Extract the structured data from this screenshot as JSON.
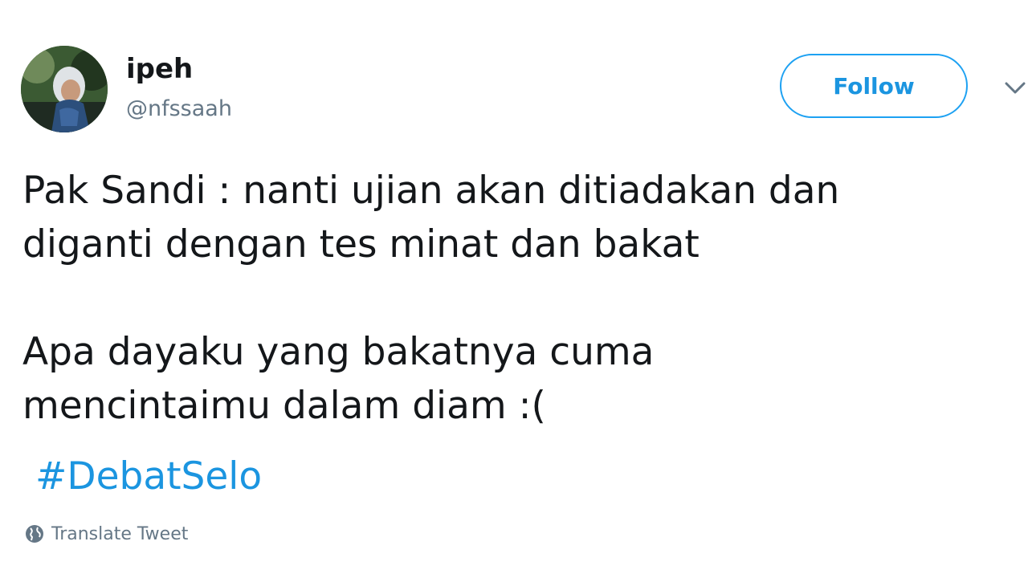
{
  "author": {
    "display_name": "ipeh",
    "handle": "@nfssaah"
  },
  "follow_button": {
    "label": "Follow"
  },
  "tweet": {
    "line1": "Pak Sandi : nanti ujian akan ditiadakan dan\ndiganti dengan tes minat dan bakat",
    "line2": "Apa dayaku yang bakatnya cuma\nmencintaimu dalam diam :(",
    "hashtag": "#DebatSelo"
  },
  "translate_link": {
    "label": "Translate Tweet",
    "icon": "globe-icon"
  },
  "menu": {
    "icon": "chevron-down-icon"
  },
  "colors": {
    "accent": "#1da1f2",
    "link": "#1b95e0",
    "text": "#14171a",
    "secondary": "#657786"
  }
}
